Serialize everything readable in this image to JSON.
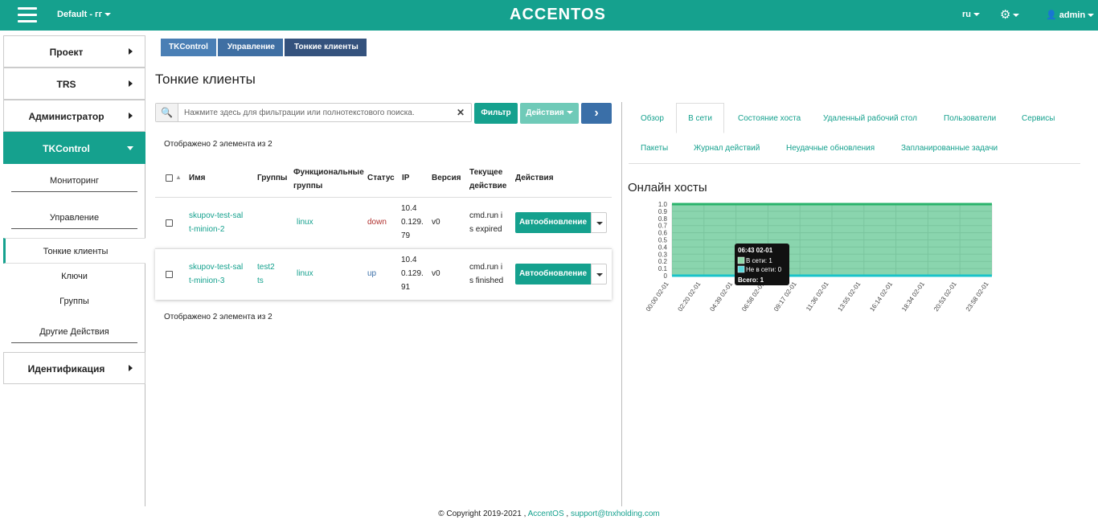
{
  "topbar": {
    "project": "Default - гг",
    "logo": "ACCENTOS",
    "lang": "ru",
    "user": "admin",
    "settings_icon": "gear-icon",
    "menu_icon": "hamburger-icon",
    "user_icon": "user-icon",
    "color": "#15a18e"
  },
  "sidebar": {
    "items": [
      {
        "label": "Проект"
      },
      {
        "label": "TRS"
      },
      {
        "label": "Администратор"
      },
      {
        "label": "TKControl"
      }
    ],
    "sub": {
      "monitoring": "Мониторинг",
      "management": "Управление",
      "thin_clients": "Тонкие клиенты",
      "keys": "Ключи",
      "groups": "Группы",
      "other": "Другие Действия"
    },
    "ident": "Идентификация"
  },
  "breadcrumb": [
    "TKControl",
    "Управление",
    "Тонкие клиенты"
  ],
  "page_title": "Тонкие клиенты",
  "search": {
    "placeholder": "Нажмите здесь для фильтрации или полнотекстового поиска."
  },
  "buttons": {
    "filter": "Фильтр",
    "actions": "Действия",
    "go": "›"
  },
  "count_text": "Отображено 2 элемента из 2",
  "table": {
    "headers": [
      "Имя",
      "Группы",
      "Функциональные группы",
      "Статус",
      "IP",
      "Версия",
      "Текущее действие",
      "Действия"
    ],
    "rows": [
      {
        "name1": "skupov-test-sal",
        "name2": "t-minion-2",
        "groups1": "",
        "groups2": "",
        "func": "linux",
        "status": "down",
        "ip1": "10.4",
        "ip2": "0.129.",
        "ip3": "79",
        "version": "v0",
        "act1": "cmd.run i",
        "act2": "s expired",
        "btn": "Автообновление"
      },
      {
        "name1": "skupov-test-sal",
        "name2": "t-minion-3",
        "groups1": "test2",
        "groups2": "ts",
        "func": "linux",
        "status": "up",
        "ip1": "10.4",
        "ip2": "0.129.",
        "ip3": "91",
        "version": "v0",
        "act1": "cmd.run i",
        "act2": "s finished",
        "btn": "Автообновление"
      }
    ]
  },
  "tabs": [
    "Обзор",
    "В сети",
    "Состояние хоста",
    "Удаленный рабочий стол",
    "Пользователи",
    "Сервисы",
    "Пакеты",
    "Журнал действий",
    "Неудачные обновления",
    "Запланированные задачи"
  ],
  "chart_title": "Онлайн хосты",
  "chart_data": {
    "type": "area",
    "x": [
      "00:00 02-01",
      "02:20 02-01",
      "04:39 02-01",
      "06:58 02-01",
      "09:17 02-01",
      "11:36 02-01",
      "13:55 02-01",
      "16:14 02-01",
      "18:34 02-01",
      "20:53 02-01",
      "23:58 02-01"
    ],
    "yticks": [
      "1.0",
      "0.9",
      "0.8",
      "0.7",
      "0.6",
      "0.5",
      "0.4",
      "0.3",
      "0.2",
      "0.1",
      "0"
    ],
    "ylim": [
      0,
      1
    ],
    "series": [
      {
        "name": "В сети",
        "values": [
          1,
          1,
          1,
          1,
          1,
          1,
          1,
          1,
          1,
          1,
          1
        ],
        "color": "#29b36b"
      },
      {
        "name": "Не в сети",
        "values": [
          0,
          0,
          0,
          0,
          0,
          0,
          0,
          0,
          0,
          0,
          0
        ],
        "color": "#19c3c9"
      }
    ],
    "tooltip": {
      "title": "06:43 02-01",
      "online": "В сети: 1",
      "offline": "Не в сети: 0",
      "total": "Всего: 1"
    }
  },
  "footer": {
    "copy": "© Copyright 2019-2021 ,",
    "accentos": "AccentOS",
    "sep": ",",
    "email": "support@tnxholding.com"
  }
}
